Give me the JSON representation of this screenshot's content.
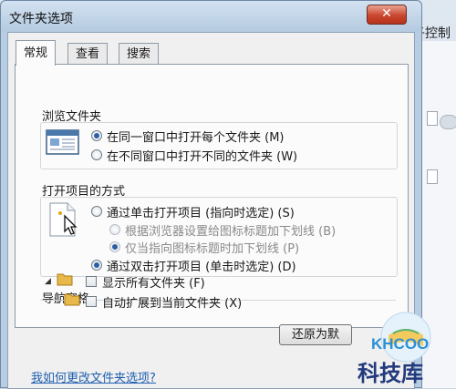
{
  "background": {
    "title_fragment": "子控制"
  },
  "dialog": {
    "title": "文件夹选项",
    "close_symbol": "✕",
    "tabs": [
      {
        "label": "常规",
        "active": true
      },
      {
        "label": "查看",
        "active": false
      },
      {
        "label": "搜索",
        "active": false
      }
    ],
    "browse_group": {
      "label": "浏览文件夹",
      "options": [
        {
          "label": "在同一窗口中打开每个文件夹 (M)",
          "checked": true
        },
        {
          "label": "在不同窗口中打开不同的文件夹 (W)",
          "checked": false
        }
      ]
    },
    "click_group": {
      "label": "打开项目的方式",
      "options": [
        {
          "label": "通过单击打开项目 (指向时选定) (S)",
          "checked": false,
          "disabled": false
        },
        {
          "label": "根据浏览器设置给图标标题加下划线 (B)",
          "checked": false,
          "disabled": true
        },
        {
          "label": "仅当指向图标标题时加下划线 (P)",
          "checked": true,
          "disabled": true
        },
        {
          "label": "通过双击打开项目 (单击时选定) (D)",
          "checked": true,
          "disabled": false
        }
      ]
    },
    "nav_group": {
      "label": "导航窗格",
      "options": [
        {
          "label": "显示所有文件夹 (F)",
          "checked": false
        },
        {
          "label": "自动扩展到当前文件夹 (X)",
          "checked": false
        }
      ]
    },
    "restore_button": "还原为默",
    "help_link": "我如何更改文件夹选项?"
  },
  "watermark": {
    "brand": "KHCOO",
    "name": "科技库"
  }
}
